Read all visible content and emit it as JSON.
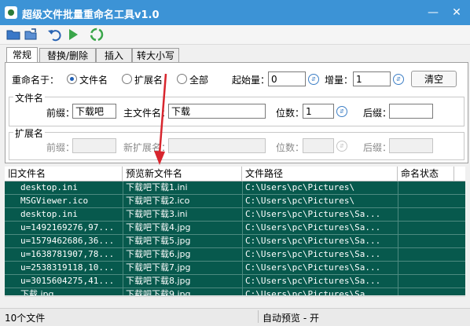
{
  "window": {
    "title": "超级文件批量重命名工具v1.0",
    "titlebar_color": "#3c93d6"
  },
  "window_buttons": {
    "minimize_icon": "minimize-icon",
    "close_icon": "close-icon"
  },
  "toolbar": {
    "icons": [
      "open-folder-icon",
      "open-file-icon",
      "undo-icon",
      "play-icon",
      "recycle-icon"
    ]
  },
  "tabs": [
    {
      "label": "常规",
      "active": true
    },
    {
      "label": "替换/删除",
      "active": false
    },
    {
      "label": "插入",
      "active": false
    },
    {
      "label": "转大小写",
      "active": false
    }
  ],
  "rename_target": {
    "label": "重命名于：",
    "options": [
      {
        "label": "文件名",
        "selected": true
      },
      {
        "label": "扩展名",
        "selected": false
      },
      {
        "label": "全部",
        "selected": false
      }
    ]
  },
  "start_value": {
    "label": "起始量：",
    "value": "0"
  },
  "increment": {
    "label": "增量：",
    "value": "1"
  },
  "clear_button": {
    "label": "清空"
  },
  "filename_group": {
    "title": "文件名",
    "prefix_label": "前缀：",
    "prefix_value": "下载吧",
    "main_label": "主文件名：",
    "main_value": "下载",
    "digits_label": "位数：",
    "digits_value": "1",
    "suffix_label": "后缀：",
    "suffix_value": ""
  },
  "extension_group": {
    "title": "扩展名",
    "prefix_label": "前缀：",
    "prefix_value": "",
    "new_ext_label": "新扩展名：",
    "new_ext_value": "",
    "digits_label": "位数：",
    "digits_value": "",
    "suffix_label": "后缀：",
    "suffix_value": ""
  },
  "grid": {
    "columns": [
      "旧文件名",
      "预览新文件名",
      "文件路径",
      "命名状态"
    ],
    "rows": [
      [
        "desktop.ini",
        "下载吧下载1.ini",
        "C:\\Users\\pc\\Pictures\\",
        ""
      ],
      [
        "MSGViewer.ico",
        "下载吧下载2.ico",
        "C:\\Users\\pc\\Pictures\\",
        ""
      ],
      [
        "desktop.ini",
        "下载吧下载3.ini",
        "C:\\Users\\pc\\Pictures\\Sa...",
        ""
      ],
      [
        "u=1492169276,97...",
        "下载吧下载4.jpg",
        "C:\\Users\\pc\\Pictures\\Sa...",
        ""
      ],
      [
        "u=1579462686,36...",
        "下载吧下载5.jpg",
        "C:\\Users\\pc\\Pictures\\Sa...",
        ""
      ],
      [
        "u=1638781907,78...",
        "下载吧下载6.jpg",
        "C:\\Users\\pc\\Pictures\\Sa...",
        ""
      ],
      [
        "u=2538319118,10...",
        "下载吧下载7.jpg",
        "C:\\Users\\pc\\Pictures\\Sa...",
        ""
      ],
      [
        "u=3015604275,41...",
        "下载吧下载8.jpg",
        "C:\\Users\\pc\\Pictures\\Sa...",
        ""
      ],
      [
        "下载.jpg",
        "下载吧下载9.jpg",
        "C:\\Users\\pc\\Pictures\\Sa...",
        ""
      ]
    ],
    "body_color": "#07594d"
  },
  "status": {
    "file_count": "10个文件",
    "preview": "自动预览 - 开"
  },
  "accent_color": "#d8262e"
}
